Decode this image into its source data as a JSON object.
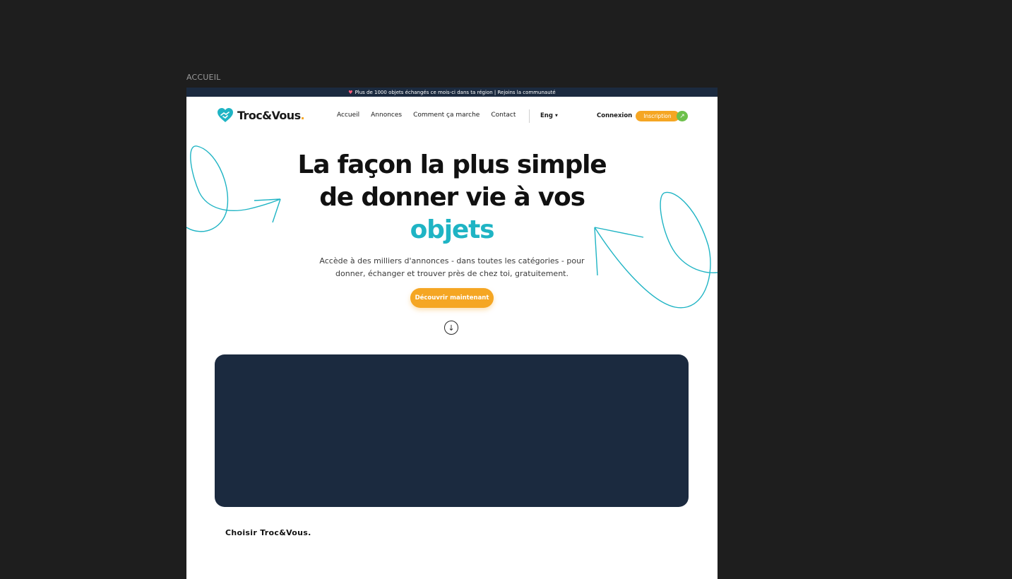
{
  "frame_label": "ACCUEIL",
  "announcement": {
    "text": "Plus de 1000 objets échangés ce mois-ci dans ta région | Rejoins la communauté"
  },
  "brand": {
    "name": "Troc&Vous",
    "dot": ".",
    "accent_color": "#1fb4c4",
    "orange_color": "#f5a623"
  },
  "nav": {
    "items": [
      {
        "label": "Accueil"
      },
      {
        "label": "Annonces"
      },
      {
        "label": "Comment ça marche"
      },
      {
        "label": "Contact"
      }
    ],
    "language": "Eng",
    "login": "Connexion",
    "signup": "Inscription"
  },
  "hero": {
    "title_line1": "La façon la plus simple",
    "title_line2": "de donner vie à vos",
    "title_line3": "objets",
    "subtitle": "Accède à des milliers d'annonces - dans toutes les catégories - pour donner, échanger et trouver près de chez toi, gratuitement.",
    "cta": "Découvrir maintenant"
  },
  "section": {
    "title": "Choisir Troc&Vous."
  }
}
